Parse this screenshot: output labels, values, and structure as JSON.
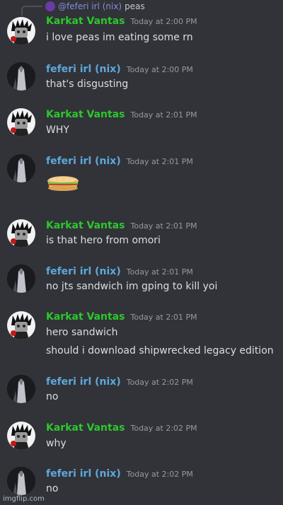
{
  "reply": {
    "mention": "@feferi irl (nix)",
    "text": "peas"
  },
  "messages": [
    {
      "author": "Karkat Vantas",
      "time": "Today at 2:00 PM",
      "lines": [
        "i love peas im eating some rn"
      ]
    },
    {
      "author": "feferi irl (nix)",
      "time": "Today at 2:00 PM",
      "lines": [
        "that's disgusting"
      ]
    },
    {
      "author": "Karkat Vantas",
      "time": "Today at 2:01 PM",
      "lines": [
        "WHY"
      ]
    },
    {
      "author": "feferi irl (nix)",
      "time": "Today at 2:01 PM",
      "lines": [],
      "attachment": "sandwich-emoji"
    },
    {
      "author": "Karkat Vantas",
      "time": "Today at 2:01 PM",
      "lines": [
        "is that hero from omori"
      ]
    },
    {
      "author": "feferi irl (nix)",
      "time": "Today at 2:01 PM",
      "lines": [
        "no jts sandwich im gping to kill yoi"
      ]
    },
    {
      "author": "Karkat Vantas",
      "time": "Today at 2:01 PM",
      "lines": [
        "hero sandwich",
        "should i download shipwrecked legacy edition"
      ]
    },
    {
      "author": "feferi irl (nix)",
      "time": "Today at 2:02 PM",
      "lines": [
        "no"
      ]
    },
    {
      "author": "Karkat Vantas",
      "time": "Today at 2:02 PM",
      "lines": [
        "why"
      ]
    },
    {
      "author": "feferi irl (nix)",
      "time": "Today at 2:02 PM",
      "lines": [
        "no"
      ]
    }
  ],
  "watermark": "imgflip.com",
  "colors": {
    "background": "#313338",
    "karkat_name": "#2dc72d",
    "feferi_name": "#5ea8dc",
    "timestamp": "#949ba4",
    "text": "#dbdee1"
  }
}
